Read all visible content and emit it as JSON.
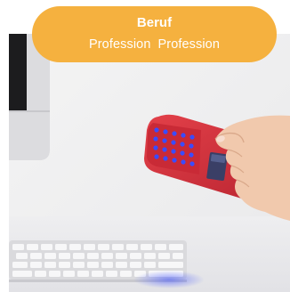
{
  "badge": {
    "title": "Beruf",
    "subtitle_parts": [
      "Profession",
      "Profession"
    ],
    "color": "#f5b13f",
    "text_color": "#ffffff"
  },
  "photo": {
    "subject": "hand-holding-red-handheld-scanner-near-monitor-and-keyboard",
    "device_color": "#d7333c",
    "led_color": "#2f48ff"
  }
}
